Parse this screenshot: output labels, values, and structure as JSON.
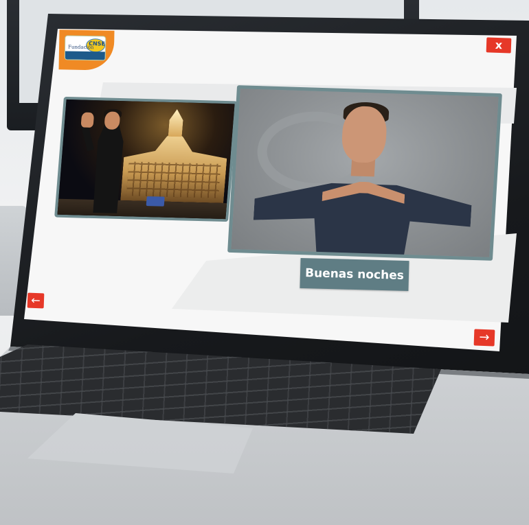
{
  "app": {
    "logo": {
      "badge": "CNSE",
      "text": "Fundación"
    },
    "close_label": "x",
    "caption_label": "Buenas noches",
    "prev_label": "←",
    "next_label": "→"
  },
  "icons": {
    "close": "close-icon",
    "prev": "arrow-left-icon",
    "next": "arrow-right-icon"
  },
  "colors": {
    "accent_red": "#e63828",
    "frame_teal": "#6f8c90",
    "caption_bg": "#5f7d84",
    "logo_orange": "#f08a24",
    "screen_bg": "#f7f7f7"
  }
}
